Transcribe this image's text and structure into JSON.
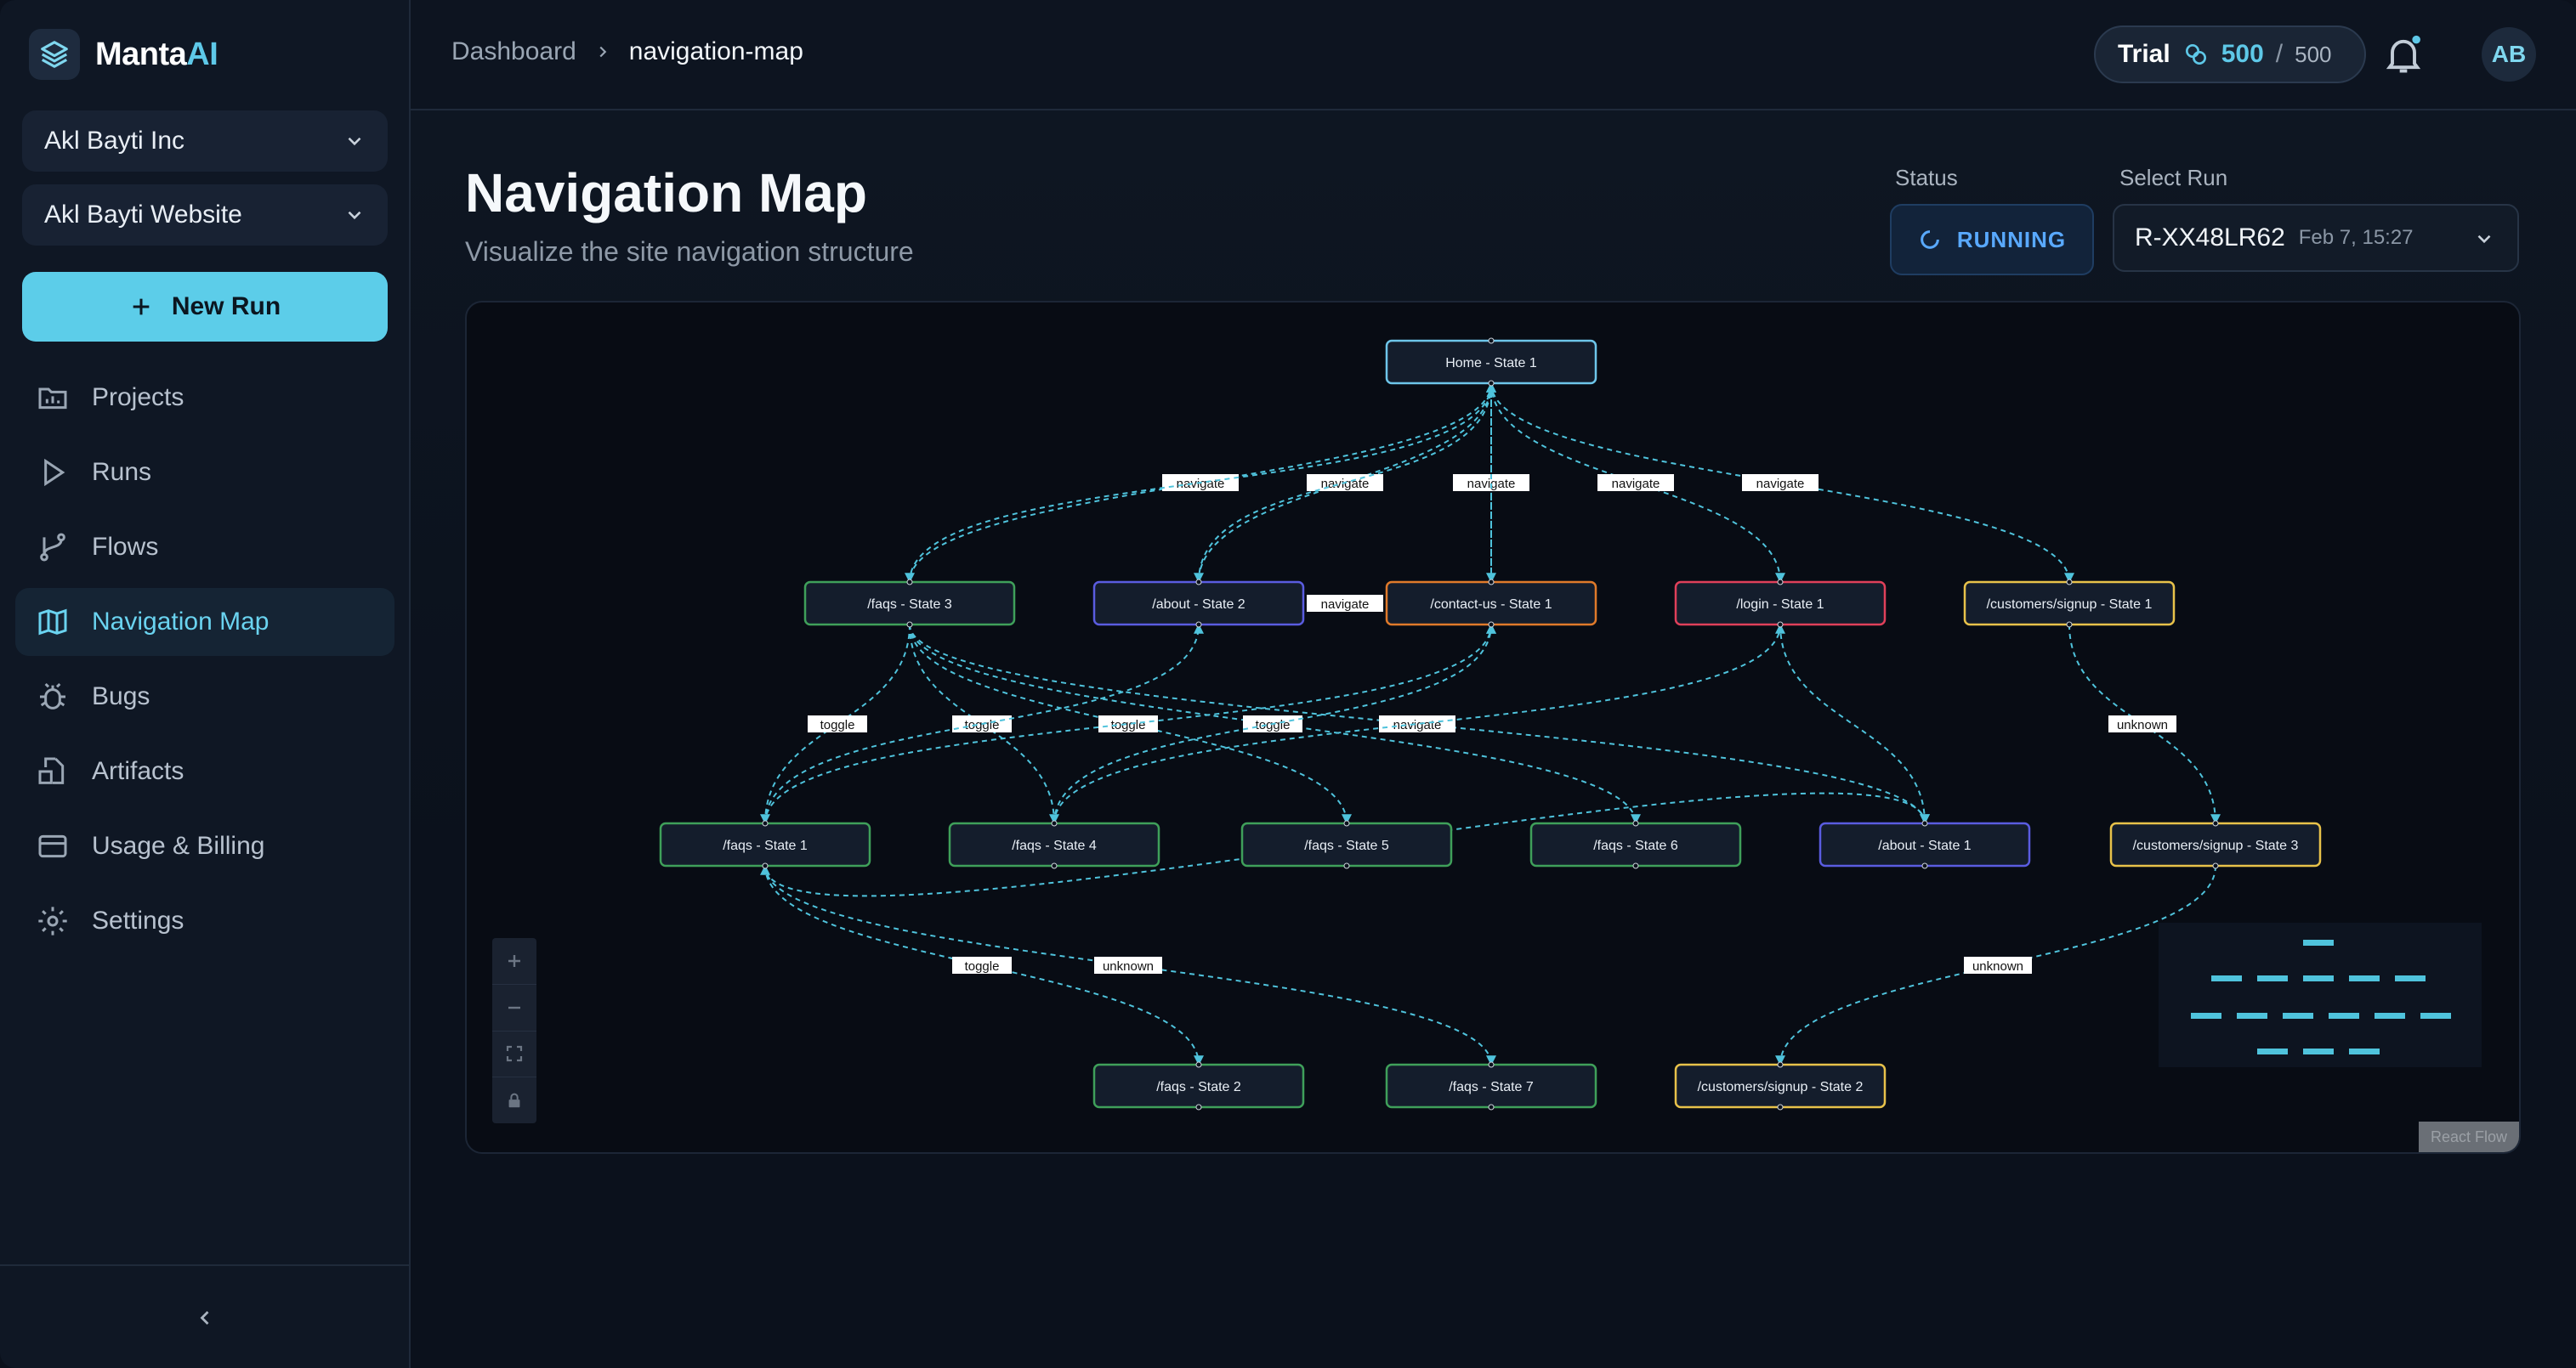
{
  "brand": {
    "name_main": "Manta",
    "name_accent": "AI"
  },
  "sidebar": {
    "org_select": "Akl Bayti Inc",
    "project_select": "Akl Bayti Website",
    "new_run_label": "New Run",
    "items": [
      {
        "label": "Projects",
        "icon": "folder-chart-icon"
      },
      {
        "label": "Runs",
        "icon": "play-icon"
      },
      {
        "label": "Flows",
        "icon": "branch-icon"
      },
      {
        "label": "Navigation Map",
        "icon": "map-icon",
        "active": true
      },
      {
        "label": "Bugs",
        "icon": "bug-icon"
      },
      {
        "label": "Artifacts",
        "icon": "file-box-icon"
      },
      {
        "label": "Usage & Billing",
        "icon": "credit-card-icon"
      },
      {
        "label": "Settings",
        "icon": "gear-icon"
      }
    ]
  },
  "header": {
    "breadcrumb": [
      "Dashboard",
      "navigation-map"
    ],
    "trial": {
      "label": "Trial",
      "current": "500",
      "separator": "/",
      "max": "500"
    },
    "avatar_initials": "AB"
  },
  "page": {
    "title": "Navigation Map",
    "subtitle": "Visualize the site navigation structure",
    "status_label": "Status",
    "status_value": "RUNNING",
    "select_run_label": "Select Run",
    "run_id": "R-XX48LR62",
    "run_date": "Feb 7, 15:27"
  },
  "graph": {
    "nodes": [
      {
        "id": "home1",
        "label": "Home - State 1",
        "color": "#6ec6ea"
      },
      {
        "id": "faqs3",
        "label": "/faqs - State 3",
        "color": "#3fa05a"
      },
      {
        "id": "about2",
        "label": "/about - State 2",
        "color": "#5a5ce0"
      },
      {
        "id": "contact1",
        "label": "/contact-us - State 1",
        "color": "#e07a2a"
      },
      {
        "id": "login1",
        "label": "/login - State 1",
        "color": "#e0405a"
      },
      {
        "id": "signup1",
        "label": "/customers/signup - State 1",
        "color": "#e8c24a"
      },
      {
        "id": "faqs1",
        "label": "/faqs - State 1",
        "color": "#3fa05a"
      },
      {
        "id": "faqs4",
        "label": "/faqs - State 4",
        "color": "#3fa05a"
      },
      {
        "id": "faqs5",
        "label": "/faqs - State 5",
        "color": "#3fa05a"
      },
      {
        "id": "faqs6",
        "label": "/faqs - State 6",
        "color": "#3fa05a"
      },
      {
        "id": "about1",
        "label": "/about - State 1",
        "color": "#5a5ce0"
      },
      {
        "id": "signup3",
        "label": "/customers/signup - State 3",
        "color": "#e8c24a"
      },
      {
        "id": "faqs2",
        "label": "/faqs - State 2",
        "color": "#3fa05a"
      },
      {
        "id": "faqs7",
        "label": "/faqs - State 7",
        "color": "#3fa05a"
      },
      {
        "id": "signup2",
        "label": "/customers/signup - State 2",
        "color": "#e8c24a"
      }
    ],
    "edge_labels": [
      "navigate",
      "navigate",
      "navigate",
      "navigate",
      "navigate",
      "navigate",
      "toggle",
      "toggle",
      "toggle",
      "toggle",
      "navigate",
      "unknown",
      "toggle",
      "unknown",
      "unknown"
    ],
    "attribution": "React Flow",
    "edge_color": "#4fc3dc"
  }
}
